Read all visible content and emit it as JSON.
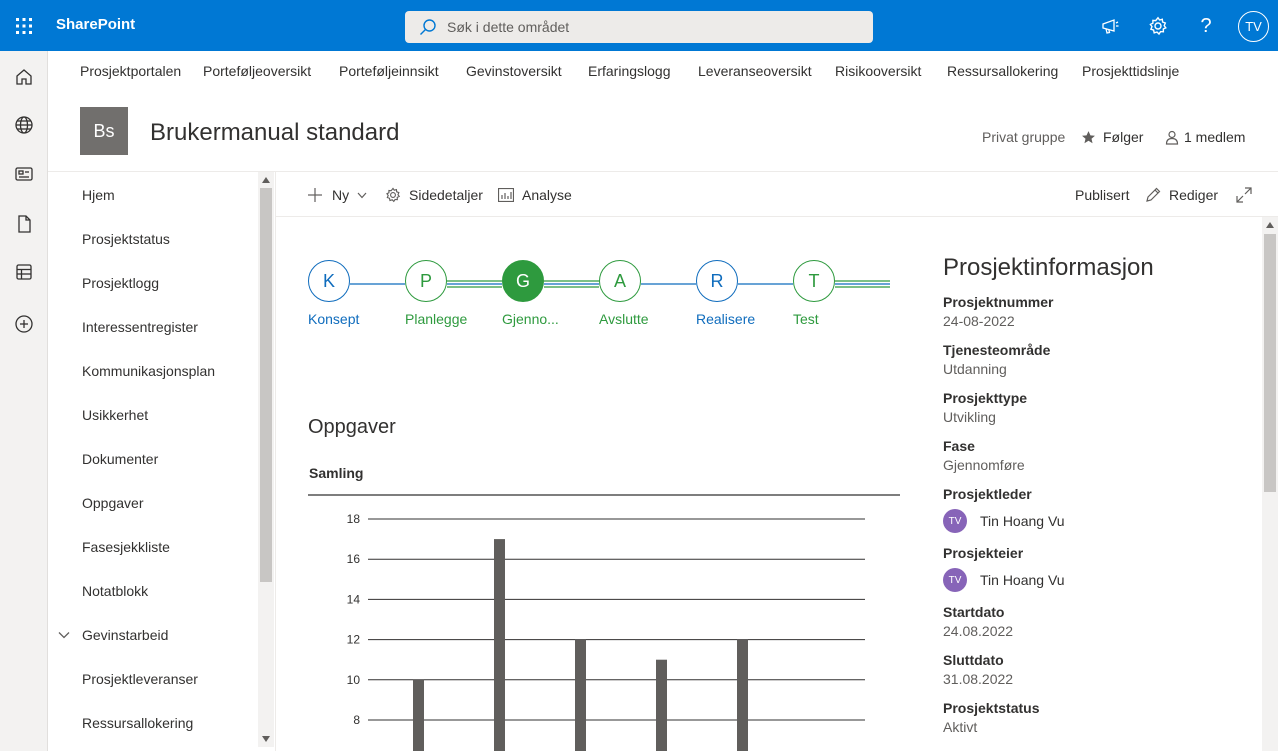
{
  "suite": {
    "app_name": "SharePoint",
    "search_placeholder": "Søk i dette området",
    "avatar_initials": "TV"
  },
  "hub_nav": [
    "Prosjektportalen",
    "Porteføljeoversikt",
    "Porteføljeinnsikt",
    "Gevinstoversikt",
    "Erfaringslogg",
    "Leveranseoversikt",
    "Risikooversikt",
    "Ressursallokering",
    "Prosjekttidslinje"
  ],
  "site": {
    "logo_initials": "Bs",
    "title": "Brukermanual standard",
    "privacy": "Privat gruppe",
    "follow": "Følger",
    "members": "1 medlem"
  },
  "left_nav": [
    "Hjem",
    "Prosjektstatus",
    "Prosjektlogg",
    "Interessentregister",
    "Kommunikasjonsplan",
    "Usikkerhet",
    "Dokumenter",
    "Oppgaver",
    "Fasesjekkliste",
    "Notatblokk",
    "Gevinstarbeid",
    "Prosjektleveranser",
    "Ressursallokering"
  ],
  "command_bar": {
    "new": "Ny",
    "page_details": "Sidedetaljer",
    "analytics": "Analyse",
    "status": "Publisert",
    "edit": "Rediger"
  },
  "phases": [
    {
      "letter": "K",
      "label": "Konsept",
      "state": "done"
    },
    {
      "letter": "P",
      "label": "Planlegge",
      "state": "upcoming"
    },
    {
      "letter": "G",
      "label": "Gjenno...",
      "state": "current"
    },
    {
      "letter": "A",
      "label": "Avslutte",
      "state": "upcoming"
    },
    {
      "letter": "R",
      "label": "Realisere",
      "state": "done"
    },
    {
      "letter": "T",
      "label": "Test",
      "state": "upcoming"
    }
  ],
  "tasks": {
    "title": "Oppgaver",
    "chart_title": "Samling"
  },
  "chart_data": {
    "type": "bar",
    "title": "Samling",
    "y_ticks": [
      8,
      10,
      12,
      14,
      16,
      18
    ],
    "ylim": [
      7,
      18.5
    ],
    "values": [
      10,
      17,
      12,
      11,
      12
    ],
    "grid": true,
    "bar_color": "#605e5c"
  },
  "project_info": {
    "heading": "Prosjektinformasjon",
    "fields": [
      {
        "label": "Prosjektnummer",
        "value": "24-08-2022"
      },
      {
        "label": "Tjenesteområde",
        "value": "Utdanning"
      },
      {
        "label": "Prosjekttype",
        "value": "Utvikling"
      },
      {
        "label": "Fase",
        "value": "Gjennomføre"
      }
    ],
    "people": [
      {
        "label": "Prosjektleder",
        "initials": "TV",
        "name": "Tin Hoang Vu"
      },
      {
        "label": "Prosjekteier",
        "initials": "TV",
        "name": "Tin Hoang Vu"
      }
    ],
    "dates": [
      {
        "label": "Startdato",
        "value": "24.08.2022"
      },
      {
        "label": "Sluttdato",
        "value": "31.08.2022"
      },
      {
        "label": "Prosjektstatus",
        "value": "Aktivt"
      }
    ]
  },
  "colors": {
    "brand": "#0078d4",
    "phase_blue": "#0f6cbd",
    "phase_green": "#2e9a3e"
  }
}
